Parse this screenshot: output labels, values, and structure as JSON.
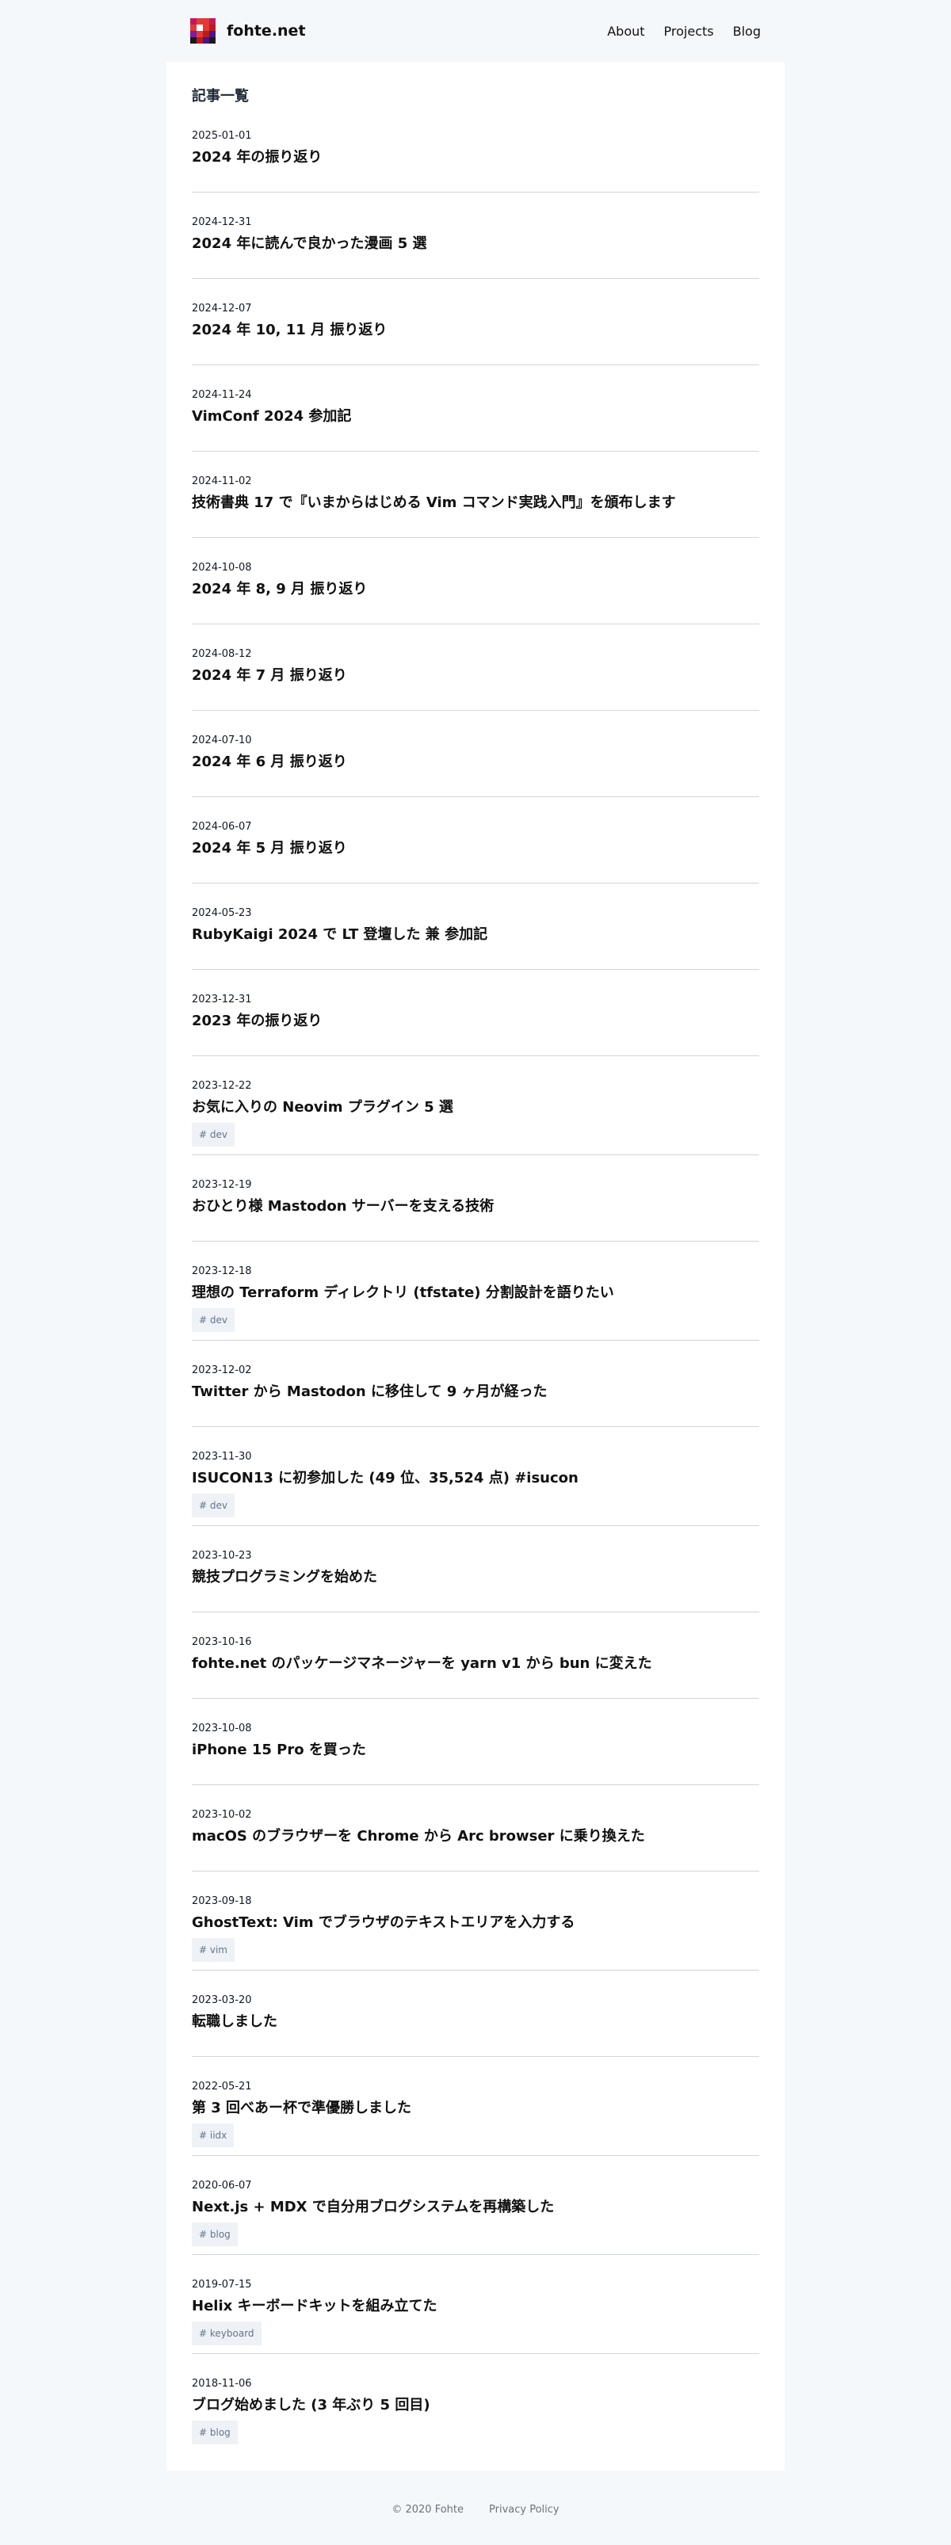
{
  "site": {
    "name": "fohte.net",
    "nav": [
      {
        "label": "About"
      },
      {
        "label": "Projects"
      },
      {
        "label": "Blog"
      }
    ]
  },
  "main": {
    "section_title": "記事一覧",
    "posts": [
      {
        "date": "2025-01-01",
        "title": "2024 年の振り返り",
        "tags": []
      },
      {
        "date": "2024-12-31",
        "title": "2024 年に読んで良かった漫画 5 選",
        "tags": []
      },
      {
        "date": "2024-12-07",
        "title": "2024 年 10, 11 月 振り返り",
        "tags": []
      },
      {
        "date": "2024-11-24",
        "title": "VimConf 2024 参加記",
        "tags": []
      },
      {
        "date": "2024-11-02",
        "title": "技術書典 17 で『いまからはじめる Vim コマンド実践入門』を頒布します",
        "tags": []
      },
      {
        "date": "2024-10-08",
        "title": "2024 年 8, 9 月 振り返り",
        "tags": []
      },
      {
        "date": "2024-08-12",
        "title": "2024 年 7 月 振り返り",
        "tags": []
      },
      {
        "date": "2024-07-10",
        "title": "2024 年 6 月 振り返り",
        "tags": []
      },
      {
        "date": "2024-06-07",
        "title": "2024 年 5 月 振り返り",
        "tags": []
      },
      {
        "date": "2024-05-23",
        "title": "RubyKaigi 2024 で LT 登壇した 兼 参加記",
        "tags": []
      },
      {
        "date": "2023-12-31",
        "title": "2023 年の振り返り",
        "tags": []
      },
      {
        "date": "2023-12-22",
        "title": "お気に入りの Neovim プラグイン 5 選",
        "tags": [
          "# dev"
        ]
      },
      {
        "date": "2023-12-19",
        "title": "おひとり様 Mastodon サーバーを支える技術",
        "tags": []
      },
      {
        "date": "2023-12-18",
        "title": "理想の Terraform ディレクトリ (tfstate) 分割設計を語りたい",
        "tags": [
          "# dev"
        ]
      },
      {
        "date": "2023-12-02",
        "title": "Twitter から Mastodon に移住して 9 ヶ月が経った",
        "tags": []
      },
      {
        "date": "2023-11-30",
        "title": "ISUCON13 に初参加した (49 位、35,524 点) #isucon",
        "tags": [
          "# dev"
        ]
      },
      {
        "date": "2023-10-23",
        "title": "競技プログラミングを始めた",
        "tags": []
      },
      {
        "date": "2023-10-16",
        "title": "fohte.net のパッケージマネージャーを yarn v1 から bun に変えた",
        "tags": []
      },
      {
        "date": "2023-10-08",
        "title": "iPhone 15 Pro を買った",
        "tags": []
      },
      {
        "date": "2023-10-02",
        "title": "macOS のブラウザーを Chrome から Arc browser に乗り換えた",
        "tags": []
      },
      {
        "date": "2023-09-18",
        "title": "GhostText: Vim でブラウザのテキストエリアを入力する",
        "tags": [
          "# vim"
        ]
      },
      {
        "date": "2023-03-20",
        "title": "転職しました",
        "tags": []
      },
      {
        "date": "2022-05-21",
        "title": "第 3 回べあー杯で準優勝しました",
        "tags": [
          "# iidx"
        ]
      },
      {
        "date": "2020-06-07",
        "title": "Next.js + MDX で自分用ブログシステムを再構築した",
        "tags": [
          "# blog"
        ]
      },
      {
        "date": "2019-07-15",
        "title": "Helix キーボードキットを組み立てた",
        "tags": [
          "# keyboard"
        ]
      },
      {
        "date": "2018-11-06",
        "title": "ブログ始めました (3 年ぶり 5 回目)",
        "tags": [
          "# blog"
        ]
      }
    ]
  },
  "footer": {
    "copyright": "© 2020 Fohte",
    "privacy": "Privacy Policy"
  },
  "colors": {
    "background": "#f5f8fb",
    "card": "#ffffff",
    "tag_bg": "#eef2f6",
    "tag_text": "#64748b",
    "divider": "#d1d5db"
  },
  "icons": {
    "logo": "pixel-art-logo-icon"
  }
}
